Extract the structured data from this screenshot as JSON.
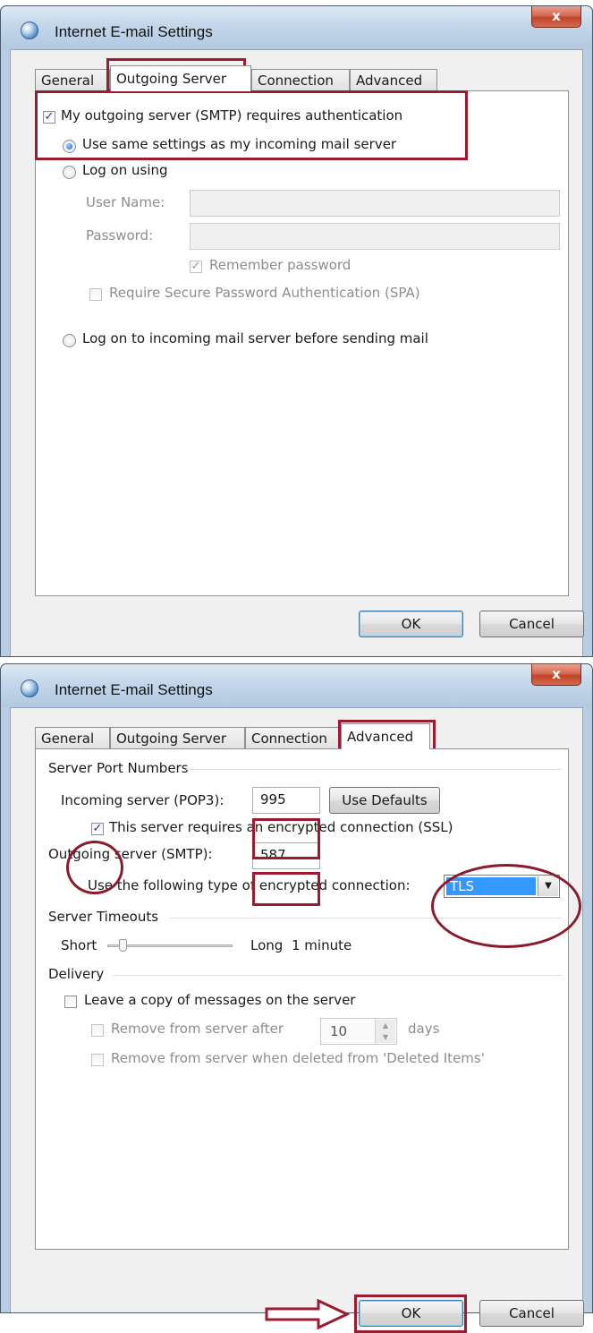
{
  "dialogs": [
    {
      "title": "Internet E-mail Settings",
      "close_glyph": "x",
      "tabs": [
        "General",
        "Outgoing Server",
        "Connection",
        "Advanced"
      ],
      "active_tab": "Outgoing Server",
      "outgoing": {
        "auth_required_label": "My outgoing server (SMTP) requires authentication",
        "auth_required_checked": true,
        "use_same_label": "Use same settings as my incoming mail server",
        "log_on_using_label": "Log on using",
        "user_name_label": "User Name:",
        "user_name_value": "",
        "password_label": "Password:",
        "password_value": "",
        "remember_password_label": "Remember password",
        "remember_password_checked": true,
        "spa_label": "Require Secure Password Authentication (SPA)",
        "log_on_incoming_label": "Log on to incoming mail server before sending mail",
        "selected_option": "use_same"
      },
      "buttons": {
        "ok": "OK",
        "cancel": "Cancel"
      }
    },
    {
      "title": "Internet E-mail Settings",
      "close_glyph": "x",
      "tabs": [
        "General",
        "Outgoing Server",
        "Connection",
        "Advanced"
      ],
      "active_tab": "Advanced",
      "advanced": {
        "server_ports_heading": "Server Port Numbers",
        "incoming_label": "Incoming server (POP3):",
        "incoming_value": "995",
        "use_defaults": "Use Defaults",
        "ssl_label": "This server requires an encrypted connection (SSL)",
        "ssl_checked": true,
        "outgoing_label": "Outgoing server (SMTP):",
        "outgoing_value": "587",
        "encryption_label": "Use the following type of encrypted connection:",
        "encryption_value": "TLS",
        "timeouts_heading": "Server Timeouts",
        "timeout_short": "Short",
        "timeout_long": "Long",
        "timeout_value": "1 minute",
        "delivery_heading": "Delivery",
        "leave_copy_label": "Leave a copy of messages on the server",
        "leave_copy_checked": false,
        "remove_after_label": "Remove from server after",
        "remove_after_value": "10",
        "remove_after_unit": "days",
        "remove_deleted_label": "Remove from server when deleted from 'Deleted Items'"
      },
      "buttons": {
        "ok": "OK",
        "cancel": "Cancel"
      }
    }
  ],
  "annotation_color": "#9b1b30",
  "icons": {
    "checked": "checkmark-icon",
    "arrow": "right-arrow-icon",
    "dropdown": "chevron-down-icon"
  }
}
